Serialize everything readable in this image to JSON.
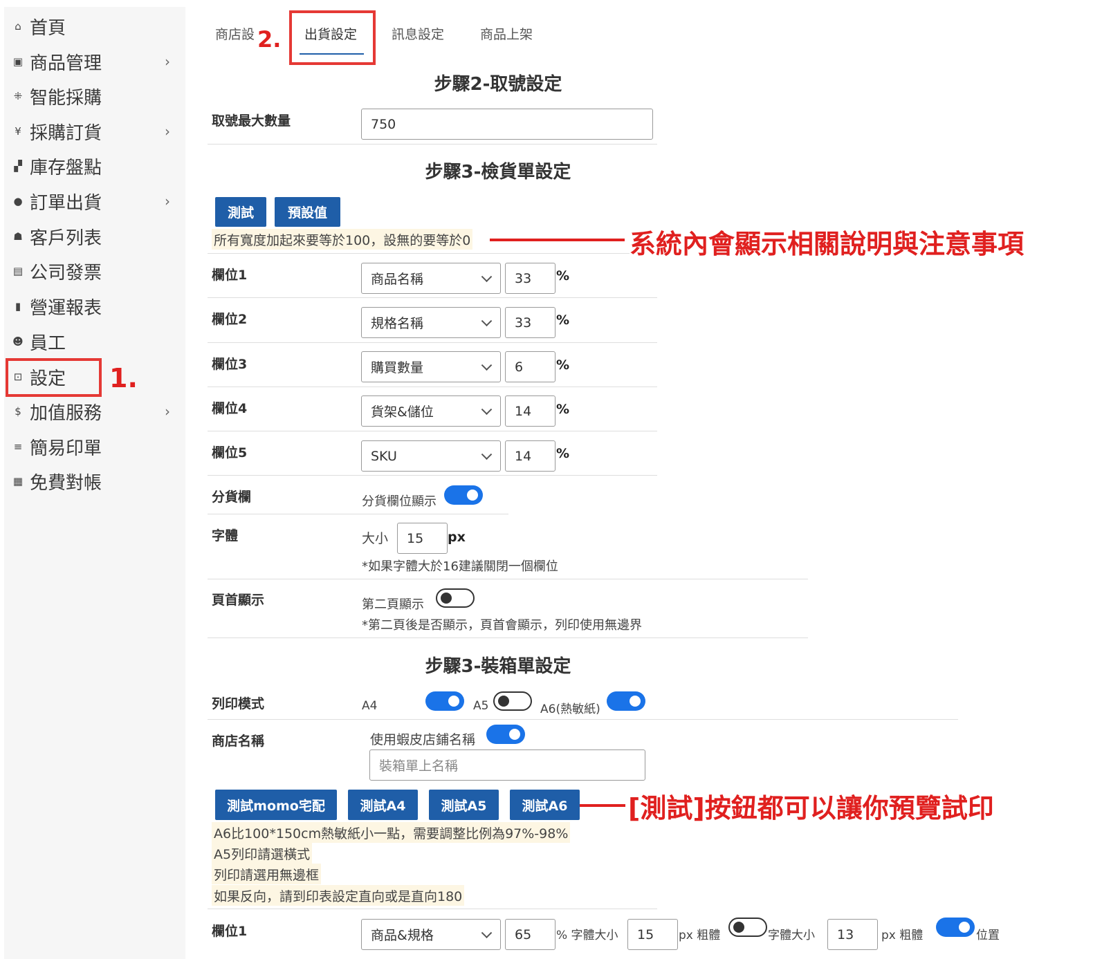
{
  "sidebar": {
    "items": [
      {
        "icon": "home-icon",
        "glyph": "⌂",
        "label": "首頁",
        "has_chevron": false
      },
      {
        "icon": "box-icon",
        "glyph": "▣",
        "label": "商品管理",
        "has_chevron": true
      },
      {
        "icon": "smart-purchase-icon",
        "glyph": "⁜",
        "label": "智能採購",
        "has_chevron": false
      },
      {
        "icon": "yen-icon",
        "glyph": "¥",
        "label": "採購訂貨",
        "has_chevron": true
      },
      {
        "icon": "pallet-icon",
        "glyph": "▞",
        "label": "庫存盤點",
        "has_chevron": false
      },
      {
        "icon": "bag-icon",
        "glyph": "●",
        "label": "訂單出貨",
        "has_chevron": true
      },
      {
        "icon": "users-icon",
        "glyph": "☗",
        "label": "客戶列表",
        "has_chevron": false
      },
      {
        "icon": "invoice-icon",
        "glyph": "▤",
        "label": "公司發票",
        "has_chevron": false
      },
      {
        "icon": "bar-chart-icon",
        "glyph": "▮",
        "label": "營運報表",
        "has_chevron": false
      },
      {
        "icon": "user-icon",
        "glyph": "☻",
        "label": "員工",
        "has_chevron": false
      },
      {
        "icon": "settings-icon",
        "glyph": "⊡",
        "label": "設定",
        "has_chevron": false
      },
      {
        "icon": "dollar-icon",
        "glyph": "$",
        "label": "加值服務",
        "has_chevron": true
      },
      {
        "icon": "menu-icon",
        "glyph": "≡",
        "label": "簡易印單",
        "has_chevron": false
      },
      {
        "icon": "calculator-icon",
        "glyph": "▦",
        "label": "免費對帳",
        "has_chevron": false
      }
    ]
  },
  "annotations": {
    "step1": "1.",
    "step2": "2.",
    "note_explain": "系統內會顯示相關說明與注意事項",
    "note_test": "[測試]按鈕都可以讓你預覽試印"
  },
  "tabs": {
    "shop": "商店設",
    "shipping": "出貨設定",
    "message": "訊息設定",
    "listing": "商品上架"
  },
  "step2": {
    "title": "步驟2-取號設定",
    "max_label": "取號最大數量",
    "max_value": "750"
  },
  "step3_pick": {
    "title": "步驟3-檢貨單設定",
    "btn_test": "測試",
    "btn_default": "預設值",
    "note": "所有寬度加起來要等於100，設無的要等於0",
    "fields": [
      {
        "label": "欄位1",
        "select": "商品名稱",
        "width": "33"
      },
      {
        "label": "欄位2",
        "select": "規格名稱",
        "width": "33"
      },
      {
        "label": "欄位3",
        "select": "購買數量",
        "width": "6"
      },
      {
        "label": "欄位4",
        "select": "貨架&儲位",
        "width": "14"
      },
      {
        "label": "欄位5",
        "select": "SKU",
        "width": "14"
      }
    ],
    "pct": "%",
    "split_label": "分貨欄",
    "split_toggle_label": "分貨欄位顯示",
    "split_on": true,
    "font_label": "字體",
    "font_size_label": "大小",
    "font_size": "15",
    "px": "px",
    "font_hint": "*如果字體大於16建議關閉一個欄位",
    "header_label": "頁首顯示",
    "header_toggle_label": "第二頁顯示",
    "header_on": false,
    "header_hint": "*第二頁後是否顯示，頁首會顯示，列印使用無邊界"
  },
  "step3_box": {
    "title": "步驟3-裝箱單設定",
    "print_mode_label": "列印模式",
    "mode_a4": "A4",
    "mode_a5": "A5",
    "mode_a6": "A6(熱敏紙)",
    "a4_on": true,
    "a5_on": false,
    "a6_on": true,
    "store_name_label": "商店名稱",
    "store_toggle_label": "使用蝦皮店鋪名稱",
    "store_on": true,
    "store_placeholder": "裝箱單上名稱",
    "btn_momo": "測試momo宅配",
    "btn_a4": "測試A4",
    "btn_a5": "測試A5",
    "btn_a6": "測試A6",
    "notes": [
      "A6比100*150cm熱敏紙小一點，需要調整比例為97%-98%",
      "A5列印請選橫式",
      "列印請選用無邊框",
      "如果反向，請到印表設定直向或是直向180"
    ],
    "field1_label": "欄位1",
    "field1_select": "商品&規格",
    "field1_width": "65",
    "pct_font": "% 字體大小",
    "field1_font": "15",
    "px_bold": "px 粗體",
    "bold1_on": false,
    "font2_label": "字體大小",
    "field1_font2": "13",
    "px_bold2": "px 粗體",
    "bold2_on": true,
    "position_label": "位置"
  }
}
